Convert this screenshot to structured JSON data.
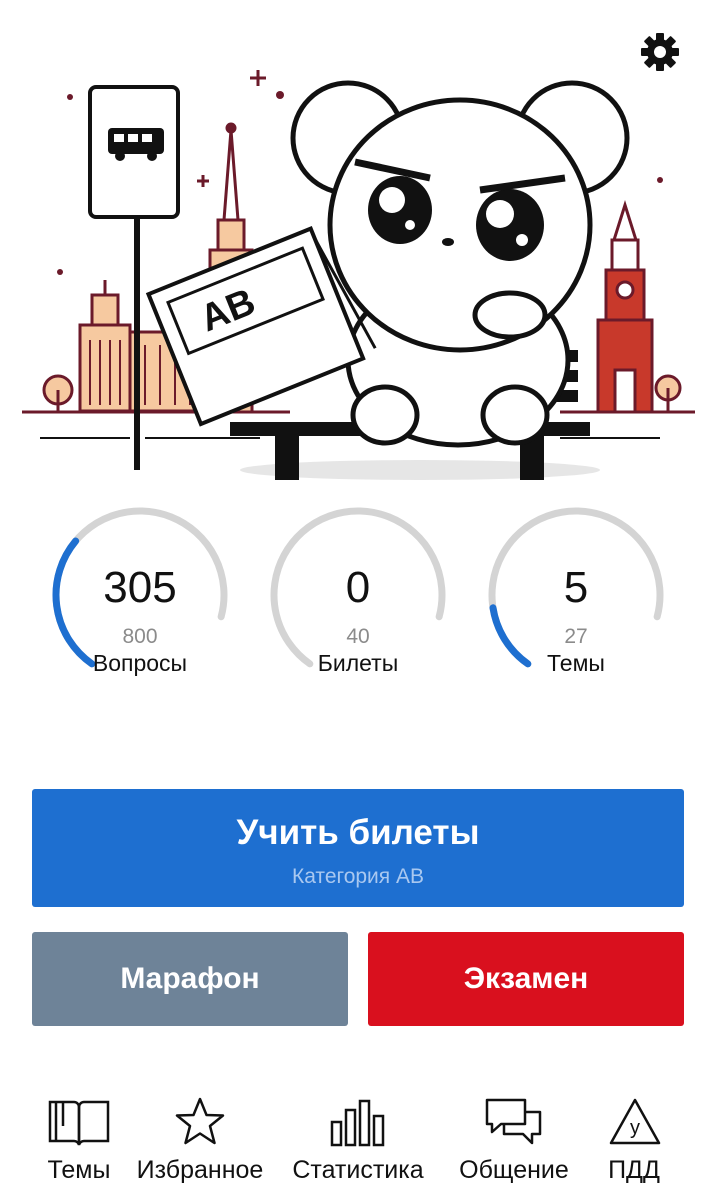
{
  "header": {
    "settings_icon": "gear-icon"
  },
  "illustration": {
    "description_icon": "hamster-bus-stop-illustration",
    "newspaper_text": "AB",
    "accent_color": "#6b1a2a"
  },
  "stats": [
    {
      "value": "305",
      "total": "800",
      "label": "Вопросы",
      "progress": 0.38
    },
    {
      "value": "0",
      "total": "40",
      "label": "Билеты",
      "progress": 0.0
    },
    {
      "value": "5",
      "total": "27",
      "label": "Темы",
      "progress": 0.185
    }
  ],
  "colors": {
    "primary": "#1e6fd0",
    "marathon": "#6e8398",
    "exam": "#d9101e",
    "progress": "#1e6fd0",
    "track": "#d4d4d4"
  },
  "actions": {
    "learn_title": "Учить билеты",
    "learn_subtitle": "Категория АВ",
    "marathon": "Марафон",
    "exam": "Экзамен"
  },
  "nav": [
    {
      "label": "Темы",
      "icon": "book-icon"
    },
    {
      "label": "Избранное",
      "icon": "star-icon"
    },
    {
      "label": "Статистика",
      "icon": "bar-chart-icon"
    },
    {
      "label": "Общение",
      "icon": "chat-bubbles-icon"
    },
    {
      "label": "ПДД",
      "icon": "road-sign-icon"
    }
  ]
}
